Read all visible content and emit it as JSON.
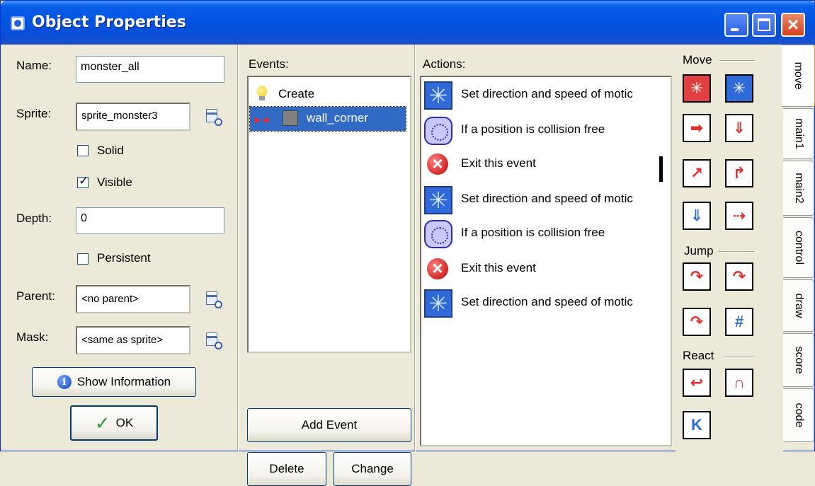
{
  "window": {
    "title": "Object Properties"
  },
  "properties": {
    "name_label": "Name:",
    "name_value": "monster_all",
    "sprite_label": "Sprite:",
    "sprite_value": "sprite_monster3",
    "solid_label": "Solid",
    "solid_checked": false,
    "visible_label": "Visible",
    "visible_checked": true,
    "depth_label": "Depth:",
    "depth_value": "0",
    "persistent_label": "Persistent",
    "persistent_checked": false,
    "parent_label": "Parent:",
    "parent_value": "<no parent>",
    "mask_label": "Mask:",
    "mask_value": "<same as sprite>",
    "show_info_label": "Show Information",
    "ok_label": "OK"
  },
  "events": {
    "label": "Events:",
    "items": [
      {
        "label": "Create",
        "icon": "lightbulb-icon",
        "selected": false
      },
      {
        "label": "wall_corner",
        "icon": "collision-icon",
        "selected": true
      }
    ],
    "add_label": "Add Event",
    "delete_label": "Delete",
    "change_label": "Change"
  },
  "actions": {
    "label": "Actions:",
    "items": [
      {
        "label": "Set direction and speed of motic",
        "icon": "move-fixed-icon"
      },
      {
        "label": "If a position is collision free",
        "icon": "check-collision-icon"
      },
      {
        "label": "Exit this event",
        "icon": "exit-event-icon"
      },
      {
        "label": "Set direction and speed of motic",
        "icon": "move-fixed-icon"
      },
      {
        "label": "If a position is collision free",
        "icon": "check-collision-icon"
      },
      {
        "label": "Exit this event",
        "icon": "exit-event-icon"
      },
      {
        "label": "Set direction and speed of motic",
        "icon": "move-fixed-icon"
      }
    ]
  },
  "toolbox": {
    "move_group": "Move",
    "jump_group": "Jump",
    "react_group": "React"
  },
  "tabs": [
    {
      "label": "move",
      "active": true
    },
    {
      "label": "main1",
      "active": false
    },
    {
      "label": "main2",
      "active": false
    },
    {
      "label": "control",
      "active": false
    },
    {
      "label": "draw",
      "active": false
    },
    {
      "label": "score",
      "active": false
    },
    {
      "label": "code",
      "active": false
    }
  ],
  "colors": {
    "titlebar": "#0054e3",
    "selection": "#316ac5",
    "face": "#ece9d8",
    "active_tab_accent": "#e68b2c"
  }
}
